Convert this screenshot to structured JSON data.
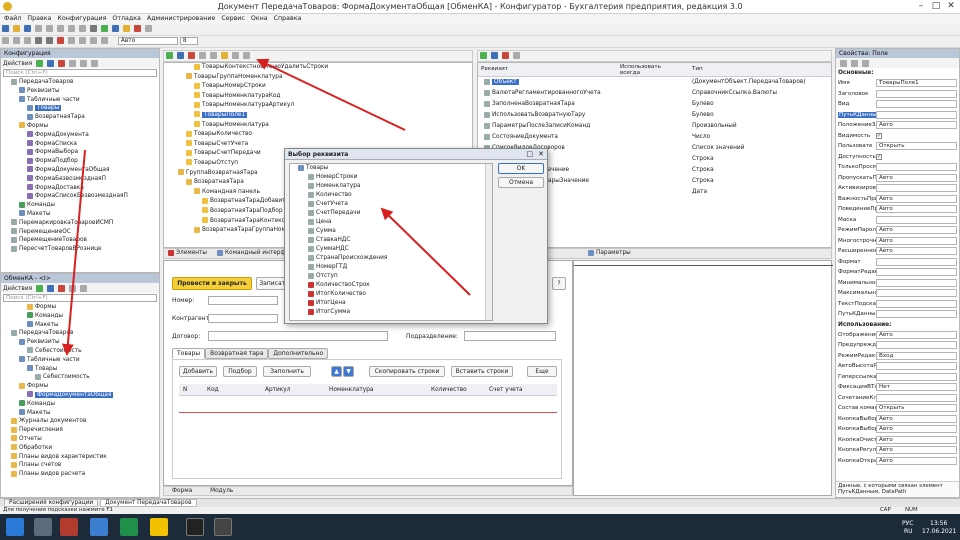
{
  "window": {
    "title": "Документ ПередачаТоваров: ФормаДокументаОбщая [ОбменКА] - Конфигуратор - Бухгалтерия предприятия, редакция 3.0"
  },
  "menu": [
    "Файл",
    "Правка",
    "Конфигурация",
    "Отладка",
    "Администрирование",
    "Сервис",
    "Окна",
    "Справка"
  ],
  "toolbar": {
    "font_select": "Авто",
    "size_select": "8"
  },
  "config_panel": {
    "title": "Конфигурация",
    "actions": "Действия",
    "search_placeholder": "Поиск (Ctrl+F)",
    "items": [
      {
        "label": "ПередачаТоваров",
        "level": 0,
        "icon": "d"
      },
      {
        "label": "Реквизиты",
        "level": 1,
        "icon": "t"
      },
      {
        "label": "Табличные части",
        "level": 1,
        "icon": "t"
      },
      {
        "label": "Товары",
        "level": 2,
        "icon": "t",
        "selected": true
      },
      {
        "label": "ВозвратнаяТара",
        "level": 2,
        "icon": "t"
      },
      {
        "label": "Формы",
        "level": 1,
        "icon": "f"
      },
      {
        "label": "ФормаДокумента",
        "level": 2,
        "icon": "m"
      },
      {
        "label": "ФормаСписка",
        "level": 2,
        "icon": "m"
      },
      {
        "label": "ФормаВыбора",
        "level": 2,
        "icon": "m"
      },
      {
        "label": "ФормаПодбор",
        "level": 2,
        "icon": "m"
      },
      {
        "label": "ФормаДокументаОбщая",
        "level": 2,
        "icon": "m"
      },
      {
        "label": "ФормаБезвозмезднаяП",
        "level": 2,
        "icon": "m"
      },
      {
        "label": "ФормаДоставка",
        "level": 2,
        "icon": "m"
      },
      {
        "label": "ФормаСписокБезвозмезднаяП",
        "level": 2,
        "icon": "m"
      },
      {
        "label": "Команды",
        "level": 1,
        "icon": "c"
      },
      {
        "label": "Макеты",
        "level": 1,
        "icon": "t"
      },
      {
        "label": "ПеремаркировкаТоваровИСМП",
        "level": 0,
        "icon": "d"
      },
      {
        "label": "ПеремещениеОС",
        "level": 0,
        "icon": "d"
      },
      {
        "label": "ПеремещениеТоваров",
        "level": 0,
        "icon": "d"
      },
      {
        "label": "ПересчетТоваровВРознице",
        "level": 0,
        "icon": "d"
      }
    ]
  },
  "exchange_panel": {
    "title": "ОбменКА - <I>",
    "actions": "Действия",
    "search_placeholder": "Поиск (Ctrl+F)",
    "items": [
      {
        "label": "Формы",
        "level": 2,
        "icon": "f"
      },
      {
        "label": "Команды",
        "level": 2,
        "icon": "c"
      },
      {
        "label": "Макеты",
        "level": 2,
        "icon": "t"
      },
      {
        "label": "ПередачаТоваров",
        "level": 0,
        "icon": "d"
      },
      {
        "label": "Реквизиты",
        "level": 1,
        "icon": "t"
      },
      {
        "label": "Себестоимость",
        "level": 2,
        "icon": "k"
      },
      {
        "label": "Табличные части",
        "level": 1,
        "icon": "t"
      },
      {
        "label": "Товары",
        "level": 2,
        "icon": "t"
      },
      {
        "label": "Себестоимость",
        "level": 3,
        "icon": "k"
      },
      {
        "label": "Формы",
        "level": 1,
        "icon": "f"
      },
      {
        "label": "ФормаДокументаОбщая",
        "level": 2,
        "icon": "m",
        "selected": true
      },
      {
        "label": "Команды",
        "level": 1,
        "icon": "c"
      },
      {
        "label": "Макеты",
        "level": 1,
        "icon": "t"
      },
      {
        "label": "Журналы документов",
        "level": 0,
        "icon": "f"
      },
      {
        "label": "Перечисления",
        "level": 0,
        "icon": "f"
      },
      {
        "label": "Отчеты",
        "level": 0,
        "icon": "f"
      },
      {
        "label": "Обработки",
        "level": 0,
        "icon": "f"
      },
      {
        "label": "Планы видов характеристик",
        "level": 0,
        "icon": "f"
      },
      {
        "label": "Планы счетов",
        "level": 0,
        "icon": "f"
      },
      {
        "label": "Планы видов расчета",
        "level": 0,
        "icon": "f"
      }
    ]
  },
  "form_tree": {
    "items": [
      {
        "label": "ТоварыКонтекстноеМенюУдалитьСтроки",
        "level": 3,
        "icon": "y"
      },
      {
        "label": "ТоварыГруппаНоменклатура",
        "level": 2,
        "icon": "f"
      },
      {
        "label": "ТоварыНомерСтроки",
        "level": 3,
        "icon": "y"
      },
      {
        "label": "ТоварыНоменклатураКод",
        "level": 3,
        "icon": "y"
      },
      {
        "label": "ТоварыНоменклатураАртикул",
        "level": 3,
        "icon": "y"
      },
      {
        "label": "ТоварыПоле1",
        "level": 3,
        "icon": "y",
        "selected": true
      },
      {
        "label": "ТоварыНоменклатура",
        "level": 3,
        "icon": "y"
      },
      {
        "label": "ТоварыКоличество",
        "level": 2,
        "icon": "y"
      },
      {
        "label": "ТоварыСчетУчета",
        "level": 2,
        "icon": "y"
      },
      {
        "label": "ТоварыСчетПередачи",
        "level": 2,
        "icon": "y"
      },
      {
        "label": "ТоварыОтступ",
        "level": 2,
        "icon": "y"
      },
      {
        "label": "ГруппаВозвратнаяТара",
        "level": 1,
        "icon": "f"
      },
      {
        "label": "ВозвратнаяТара",
        "level": 2,
        "icon": "f"
      },
      {
        "label": "Командная панель",
        "level": 3,
        "icon": "f"
      },
      {
        "label": "ВозвратнаяТараДобавить",
        "level": 4,
        "icon": "y"
      },
      {
        "label": "ВозвратнаяТараПодбор",
        "level": 4,
        "icon": "y"
      },
      {
        "label": "ВозвратнаяТараКонтекстноеМеню",
        "level": 4,
        "icon": "y"
      },
      {
        "label": "ВозвратнаяТараГруппаНоменклатура",
        "level": 3,
        "icon": "f"
      }
    ],
    "tabs": [
      "Элементы",
      "Командный интерфейс"
    ]
  },
  "attr_tree": {
    "headers": {
      "attr": "Реквизит",
      "use_always": "Использовать всегда",
      "type": "Тип"
    },
    "rows": [
      {
        "name": "Объект",
        "type": "(ДокументОбъект.ПередачаТоваров)",
        "selected": true
      },
      {
        "name": "ВалютаРегламентированногоУчета",
        "type": "СправочникСсылка.Валюты"
      },
      {
        "name": "ЗаполненаВозвратнаяТара",
        "type": "Булево"
      },
      {
        "name": "ИспользоватьВозвратнуюТару",
        "type": "Булево"
      },
      {
        "name": "ПараметрыПослеЗаписиКоманд",
        "type": "Произвольный"
      },
      {
        "name": "СостояниеДокумента",
        "type": "Число"
      },
      {
        "name": "СписокВидовДоговоров",
        "type": "Список значений"
      },
      {
        "name": "СтоимостьТары",
        "type": "Строка"
      },
      {
        "name": "СтоимостьТарыЗначение",
        "type": "Строка"
      },
      {
        "name": "СуммаСтоимостьТарыЗначение",
        "type": "Строка"
      },
      {
        "name": "...",
        "type": "Дата"
      }
    ],
    "tabs": [
      "Параметры"
    ]
  },
  "dialog": {
    "title": "Выбор реквизита",
    "ok": "OK",
    "cancel": "Отмена",
    "items": [
      {
        "label": "Товары",
        "level": 0,
        "icon": "t"
      },
      {
        "label": "НомерСтроки",
        "level": 1,
        "icon": "k"
      },
      {
        "label": "Номенклатура",
        "level": 1,
        "icon": "k"
      },
      {
        "label": "Количество",
        "level": 1,
        "icon": "k"
      },
      {
        "label": "СчетУчета",
        "level": 1,
        "icon": "k"
      },
      {
        "label": "СчетПередачи",
        "level": 1,
        "icon": "k"
      },
      {
        "label": "Цена",
        "level": 1,
        "icon": "k"
      },
      {
        "label": "Сумма",
        "level": 1,
        "icon": "k"
      },
      {
        "label": "СтавкаНДС",
        "level": 1,
        "icon": "k"
      },
      {
        "label": "СуммаНДС",
        "level": 1,
        "icon": "k"
      },
      {
        "label": "СтранаПроисхождения",
        "level": 1,
        "icon": "k"
      },
      {
        "label": "НомерГТД",
        "level": 1,
        "icon": "k"
      },
      {
        "label": "Отступ",
        "level": 1,
        "icon": "k"
      },
      {
        "label": "КоличествоСтрок",
        "level": 1,
        "icon": "s"
      },
      {
        "label": "ИтогКоличество",
        "level": 1,
        "icon": "s"
      },
      {
        "label": "ИтогЦена",
        "level": 1,
        "icon": "s"
      },
      {
        "label": "ИтогСумма",
        "level": 1,
        "icon": "s"
      }
    ]
  },
  "form_preview": {
    "post_close": "Провести и закрыть",
    "write": "Записать",
    "help": "?",
    "number_label": "Номер:",
    "counterparty_label": "Контрагент:",
    "contract_label": "Договор:",
    "department_label": "Подразделение:",
    "tabs": [
      "Товары",
      "Возвратная тара",
      "Дополнительно"
    ],
    "buttons": [
      "Добавить",
      "Подбор",
      "Заполнить",
      "Скопировать строки",
      "Вставить строки",
      "Еще"
    ],
    "columns": [
      "N",
      "Код",
      "Артикул",
      "Номенклатура",
      "Количество",
      "Счет учета"
    ],
    "bottom_tabs": [
      "Форма",
      "Модуль"
    ]
  },
  "properties": {
    "title": "Свойства: Поле",
    "main_section": "Основные:",
    "use_section": "Использование:",
    "main_rows": [
      {
        "label": "Имя",
        "value": "ТоварыПоле1"
      },
      {
        "label": "Заголовок",
        "value": ""
      },
      {
        "label": "Вид",
        "value": ""
      },
      {
        "label": "ПутьКДанным",
        "value": "",
        "highlight": true
      },
      {
        "label": "ПоложениеЗа",
        "value": "Авто"
      },
      {
        "label": "Видимость",
        "value": "",
        "checkbox": true
      },
      {
        "label": "Пользовате",
        "value": "Открыть"
      },
      {
        "label": "Доступность",
        "value": "",
        "checkbox": true
      },
      {
        "label": "ТолькоПросм",
        "value": ""
      },
      {
        "label": "ПропускатьП",
        "value": "Авто"
      },
      {
        "label": "Активизиров",
        "value": ""
      },
      {
        "label": "ВажностьПри",
        "value": "Авто"
      },
      {
        "label": "ПоведениеПр",
        "value": "Авто"
      },
      {
        "label": "Маска",
        "value": ""
      },
      {
        "label": "РежимПароля",
        "value": "Авто"
      },
      {
        "label": "Многострочн",
        "value": "Авто"
      },
      {
        "label": "Расширенное",
        "value": "Авто"
      },
      {
        "label": "Формат",
        "value": ""
      },
      {
        "label": "ФорматРедак",
        "value": ""
      },
      {
        "label": "Минимальное",
        "value": ""
      },
      {
        "label": "Максимально",
        "value": ""
      },
      {
        "label": "ТекстПодска",
        "value": ""
      },
      {
        "label": "ПутьКДанным",
        "value": ""
      }
    ],
    "use_rows": [
      {
        "label": "Отображение",
        "value": "Авто"
      },
      {
        "label": "Предупрежден",
        "value": ""
      },
      {
        "label": "РежимРедакт",
        "value": "Вход"
      },
      {
        "label": "АвтоВысотаЯ",
        "value": ""
      },
      {
        "label": "Гиперссылка",
        "value": ""
      },
      {
        "label": "ФиксацияВТа",
        "value": "Нет"
      },
      {
        "label": "СочетаниеКла",
        "value": ""
      },
      {
        "label": "Состав коман",
        "value": "Открыть"
      },
      {
        "label": "КнопкаВыбор",
        "value": "Авто"
      },
      {
        "label": "КнопкаВыбор",
        "value": "Авто"
      },
      {
        "label": "КнопкаОчист",
        "value": "Авто"
      },
      {
        "label": "КнопкаРегул",
        "value": "Авто"
      },
      {
        "label": "КнопкаОткры",
        "value": "Авто"
      }
    ],
    "footer": "Данные, с которыми связан элемент ПутьКДанным, DataPath"
  },
  "window_tabs": [
    "Расширения конфигурации",
    "Документ ПередачаТоваров"
  ],
  "status": {
    "hint": "Для получения подсказки нажмите F1",
    "caps": "CAP",
    "num": "NUM",
    "lang1": "РУС",
    "lang2": "RU",
    "time": "13:56",
    "date": "17.06.2021"
  }
}
